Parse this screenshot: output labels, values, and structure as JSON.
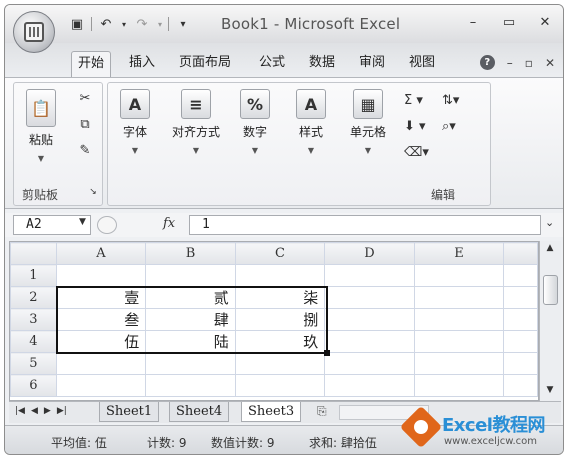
{
  "window": {
    "title": "Book1 - Microsoft Excel"
  },
  "quick_access": [
    "save-icon",
    "undo-icon",
    "redo-icon",
    "customize-icon"
  ],
  "window_controls": {
    "minimize": "–",
    "maximize": "▭",
    "close": "✕"
  },
  "ribbon_tabs": [
    "开始",
    "插入",
    "页面布局",
    "公式",
    "数据",
    "审阅",
    "视图"
  ],
  "ribbon_right": {
    "help": "?",
    "min": "–",
    "restore": "▫",
    "close": "✕"
  },
  "ribbon": {
    "clipboard": {
      "paste": "粘贴",
      "group": "剪贴板"
    },
    "font": {
      "label": "字体"
    },
    "alignment": {
      "label": "对齐方式"
    },
    "number": {
      "label": "数字"
    },
    "styles": {
      "label": "样式"
    },
    "cells": {
      "label": "单元格"
    },
    "editing": {
      "group": "编辑"
    }
  },
  "formula_bar": {
    "name_box": "A2",
    "fx": "fx",
    "content": "1"
  },
  "columns": [
    "A",
    "B",
    "C",
    "D",
    "E"
  ],
  "rows": [
    {
      "n": "1",
      "cells": [
        "",
        "",
        "",
        "",
        ""
      ]
    },
    {
      "n": "2",
      "cells": [
        "壹",
        "贰",
        "柒",
        "",
        ""
      ]
    },
    {
      "n": "3",
      "cells": [
        "叁",
        "肆",
        "捌",
        "",
        ""
      ]
    },
    {
      "n": "4",
      "cells": [
        "伍",
        "陆",
        "玖",
        "",
        ""
      ]
    },
    {
      "n": "5",
      "cells": [
        "",
        "",
        "",
        "",
        ""
      ]
    },
    {
      "n": "6",
      "cells": [
        "",
        "",
        "",
        "",
        ""
      ]
    }
  ],
  "sheets": [
    "Sheet1",
    "Sheet4",
    "Sheet3"
  ],
  "active_sheet": "Sheet3",
  "status": {
    "average": "平均值: 伍",
    "count": "计数: 9",
    "numeric_count": "数值计数: 9",
    "sum": "求和: 肆拾伍"
  },
  "watermark": {
    "text": "Excel教程网",
    "url": "www.exceljcw.com"
  }
}
